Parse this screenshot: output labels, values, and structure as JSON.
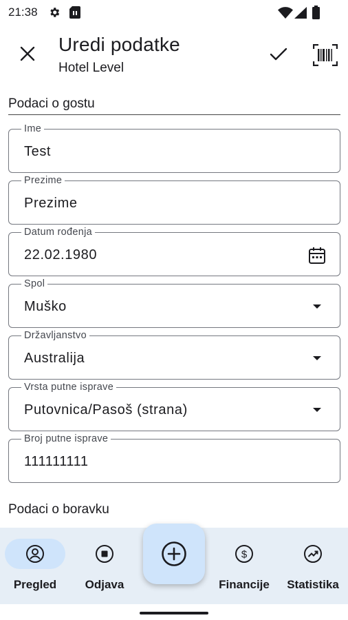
{
  "status_bar": {
    "time": "21:38"
  },
  "app_bar": {
    "title": "Uredi podatke",
    "subtitle": "Hotel Level",
    "icons": {
      "close": "close-icon",
      "confirm": "check-icon",
      "scan": "barcode-scan-icon"
    }
  },
  "sections": {
    "guest": "Podaci o gostu",
    "stay": "Podaci o boravku"
  },
  "fields": [
    {
      "label": "Ime",
      "value": "Test",
      "kind": "text"
    },
    {
      "label": "Prezime",
      "value": "Prezime",
      "kind": "text"
    },
    {
      "label": "Datum rođenja",
      "value": "22.02.1980",
      "kind": "date"
    },
    {
      "label": "Spol",
      "value": "Muško",
      "kind": "select"
    },
    {
      "label": "Državljanstvo",
      "value": "Australija",
      "kind": "select"
    },
    {
      "label": "Vrsta putne isprave",
      "value": "Putovnica/Pasoš (strana)",
      "kind": "select"
    },
    {
      "label": "Broj putne isprave",
      "value": "111111111",
      "kind": "text"
    }
  ],
  "bottom_nav": {
    "items": [
      {
        "label": "Pregled",
        "icon": "account-circle-icon",
        "active": true
      },
      {
        "label": "Odjava",
        "icon": "stop-circle-icon",
        "active": false
      },
      {
        "label": "Financije",
        "icon": "dollar-circle-icon",
        "active": false
      },
      {
        "label": "Statistika",
        "icon": "trending-up-circle-icon",
        "active": false
      }
    ],
    "fab_icon": "add-circle-icon"
  },
  "colors": {
    "accent": "#cfe4fb",
    "nav_background": "#e6eef6",
    "outline": "#74777f"
  }
}
